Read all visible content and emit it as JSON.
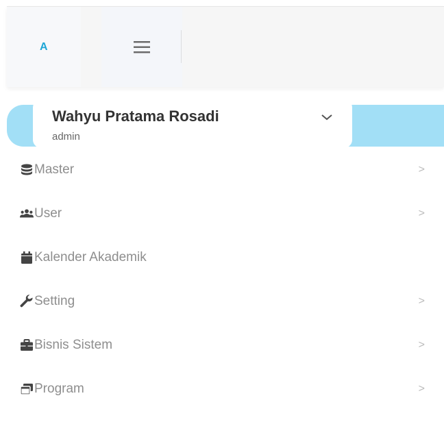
{
  "brand": {
    "text": "A",
    "color": "#1ea6d6"
  },
  "header": {
    "menu_toggle_icon": "hamburger-icon"
  },
  "profile": {
    "name": "Wahyu Pratama Rosadi",
    "role": "admin",
    "dropdown_icon": "chevron-down-icon",
    "accent_color": "#a2dff6"
  },
  "sidebar": {
    "items": [
      {
        "label": "Master",
        "icon": "database-icon",
        "has_arrow": true,
        "arrow": ">"
      },
      {
        "label": "User",
        "icon": "users-icon",
        "has_arrow": true,
        "arrow": ">"
      },
      {
        "label": "Kalender Akademik",
        "icon": "calendar-icon",
        "has_arrow": false
      },
      {
        "label": "Setting",
        "icon": "wrench-icon",
        "has_arrow": true,
        "arrow": ">"
      },
      {
        "label": "Bisnis Sistem",
        "icon": "briefcase-icon",
        "has_arrow": true,
        "arrow": ">"
      },
      {
        "label": "Program",
        "icon": "window-restore-icon",
        "has_arrow": true,
        "arrow": ">"
      }
    ]
  }
}
